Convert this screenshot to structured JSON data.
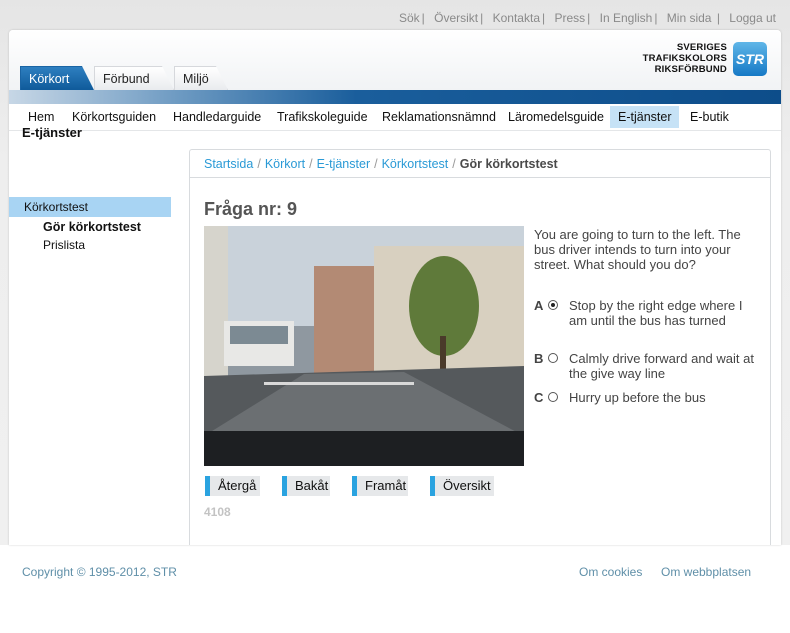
{
  "top_links": [
    "Sök",
    "Översikt",
    "Kontakta",
    "Press",
    "In English",
    "Min sida",
    "Logga ut"
  ],
  "logo": {
    "line1": "SVERIGES",
    "line2": "TRAFIKSKOLORS",
    "line3": "RIKSFÖRBUND",
    "badge": "STR"
  },
  "tabs": [
    {
      "label": "Körkort",
      "active": true
    },
    {
      "label": "Förbund",
      "active": false
    },
    {
      "label": "Miljö",
      "active": false
    }
  ],
  "nav": [
    {
      "label": "Hem"
    },
    {
      "label": "Körkortsguiden"
    },
    {
      "label": "Handledarguide"
    },
    {
      "label": "Trafikskoleguide"
    },
    {
      "label": "Reklamationsnämnd"
    },
    {
      "label": "Läromedelsguide"
    },
    {
      "label": "E-tjänster",
      "active": true
    },
    {
      "label": "E-butik"
    }
  ],
  "sidebar": {
    "title": "E-tjänster",
    "items": [
      {
        "label": "Körkortstest"
      },
      {
        "label": "Gör körkortstest"
      },
      {
        "label": "Prislista"
      }
    ]
  },
  "breadcrumb": [
    "Startsida",
    "Körkort",
    "E-tjänster",
    "Körkortstest"
  ],
  "breadcrumb_current": "Gör körkortstest",
  "question": {
    "title": "Fråga nr: 9",
    "text": "You are going to turn to the left. The bus driver intends to turn into your street. What should you do?",
    "answers": [
      {
        "letter": "A",
        "text": "Stop by the right edge where I am until the bus has turned",
        "selected": true
      },
      {
        "letter": "B",
        "text": "Calmly drive forward and wait at the give way line",
        "selected": false
      },
      {
        "letter": "C",
        "text": "Hurry up before the bus",
        "selected": false
      }
    ],
    "id": "4108"
  },
  "buttons": {
    "back": "Återgå",
    "prev": "Bakåt",
    "next": "Framåt",
    "overview": "Översikt"
  },
  "footer": {
    "copyright": "Copyright © 1995-2012, STR",
    "cookies": "Om cookies",
    "about": "Om webbplatsen"
  },
  "colors": {
    "accent_blue": "#0d4d8a",
    "link_blue": "#2a9ad6",
    "active_tab_bg": "#a8d4f3"
  }
}
